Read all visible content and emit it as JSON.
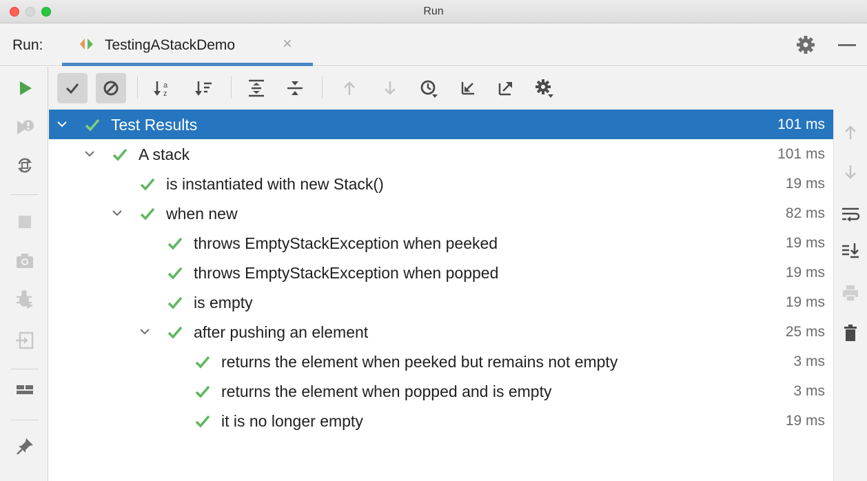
{
  "window": {
    "title": "Run"
  },
  "run_header": {
    "label": "Run:",
    "tab_label": "TestingAStackDemo",
    "tab_close": "×"
  },
  "colors": {
    "selection": "#2675bf",
    "check": "#5fb85f",
    "tab_underline": "#4a88c7"
  },
  "left_toolbar": [
    "run-icon",
    "rerun-failed-icon",
    "toggle-auto-test-icon",
    "stop-icon",
    "screenshot-icon",
    "debug-icon",
    "exit-icon",
    "layout-icon",
    "pin-icon"
  ],
  "top_toolbar": [
    "show-passed-icon",
    "show-ignored-icon",
    "sort-alphabetically-icon",
    "sort-by-duration-icon",
    "expand-all-icon",
    "collapse-all-icon",
    "previous-failed-icon",
    "next-failed-icon",
    "test-history-icon",
    "import-tests-icon",
    "export-results-icon",
    "settings-icon"
  ],
  "right_toolbar": [
    "up-arrow-icon",
    "down-arrow-icon",
    "soft-wrap-icon",
    "scroll-to-end-icon",
    "print-icon",
    "trash-icon"
  ],
  "tree": {
    "rows": [
      {
        "label": "Test Results",
        "time": "101 ms",
        "depth": 0,
        "expanded": true,
        "selected": true
      },
      {
        "label": "A stack",
        "time": "101 ms",
        "depth": 1,
        "expanded": true
      },
      {
        "label": "is instantiated with new Stack()",
        "time": "19 ms",
        "depth": 2
      },
      {
        "label": "when new",
        "time": "82 ms",
        "depth": 2,
        "expanded": true
      },
      {
        "label": "throws EmptyStackException when peeked",
        "time": "19 ms",
        "depth": 3
      },
      {
        "label": "throws EmptyStackException when popped",
        "time": "19 ms",
        "depth": 3
      },
      {
        "label": "is empty",
        "time": "19 ms",
        "depth": 3
      },
      {
        "label": "after pushing an element",
        "time": "25 ms",
        "depth": 3,
        "expanded": true
      },
      {
        "label": "returns the element when peeked but remains not empty",
        "time": "3 ms",
        "depth": 4
      },
      {
        "label": "returns the element when popped and is empty",
        "time": "3 ms",
        "depth": 4
      },
      {
        "label": "it is no longer empty",
        "time": "19 ms",
        "depth": 4
      }
    ]
  }
}
